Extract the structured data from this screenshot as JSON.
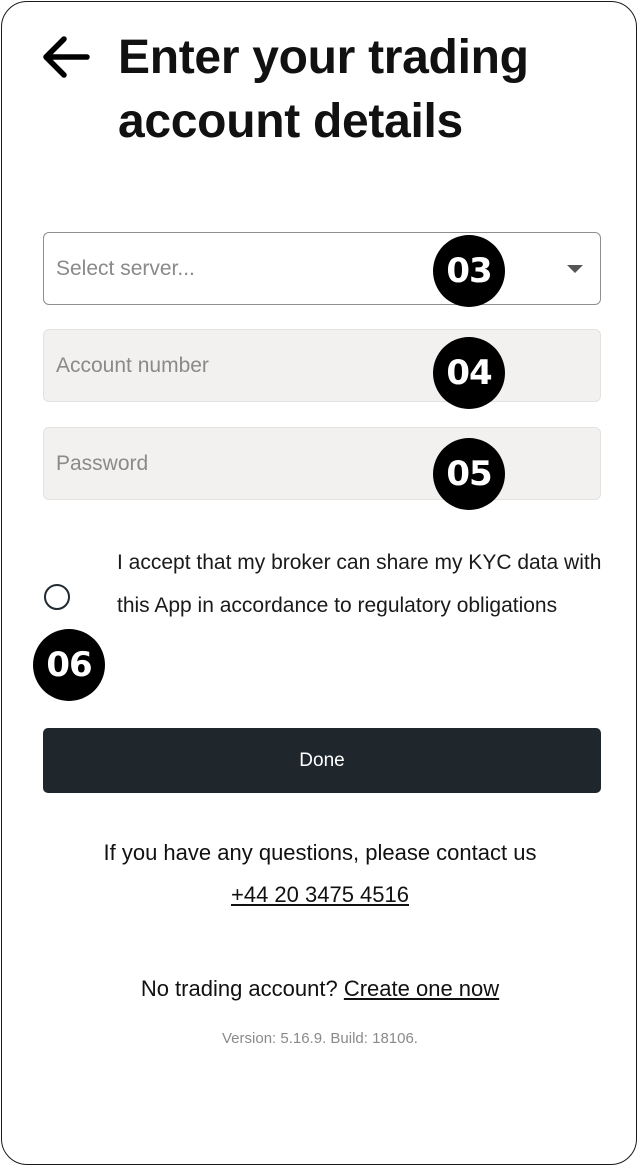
{
  "header": {
    "back_icon": "arrow-left-icon",
    "title": "Enter your trading account details"
  },
  "form": {
    "server_placeholder": "Select server...",
    "account_placeholder": "Account number",
    "password_placeholder": "Password",
    "consent_text": "I accept that my broker can share my KYC data with this App in accordance to regulatory obligations",
    "done_label": "Done"
  },
  "badges": {
    "server": "03",
    "account": "04",
    "password": "05",
    "consent": "06"
  },
  "footer": {
    "contact_text": "If you have any questions, please contact us",
    "phone": "+44 20 3475 4516",
    "no_account_text": "No trading account?",
    "create_link": "Create one now",
    "version": "Version: 5.16.9. Build: 18106."
  },
  "colors": {
    "primary_button": "#1f262c",
    "input_background": "#f2f1ef",
    "badge": "#000000"
  }
}
